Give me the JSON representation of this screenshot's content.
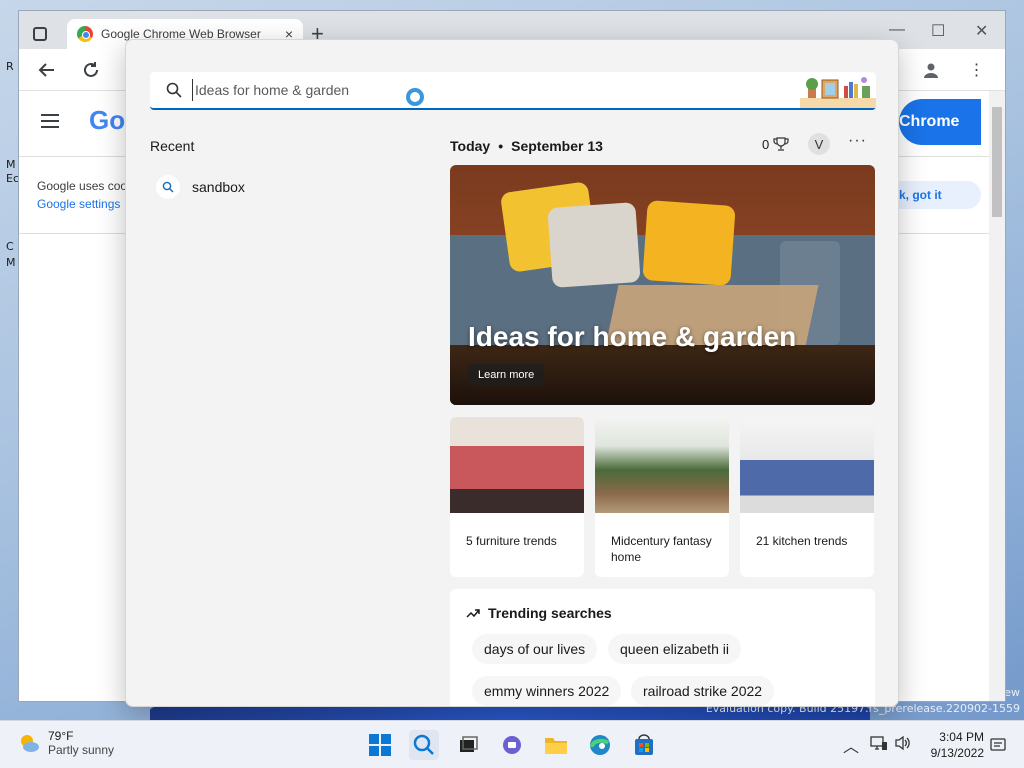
{
  "desktop": {
    "icon_fragments": [
      "R",
      "M",
      "Ec",
      "C",
      "M"
    ],
    "watermark": "Evaluation copy. Build 25197.rs_prerelease.220902-1559",
    "watermark_top": "ew"
  },
  "chrome": {
    "tab_title": "Google Chrome Web Browser",
    "tab_close": "×",
    "new_tab": "+",
    "minimize": "—",
    "maximize": "☐",
    "close": "✕",
    "logo_text": "Goo",
    "get_chrome_label": "Chrome",
    "consent_text": "Google uses coo",
    "consent_link": "Google settings",
    "got_it_label": "k, got it"
  },
  "search": {
    "placeholder": "Ideas for home & garden",
    "recent_heading": "Recent",
    "recent_items": [
      {
        "label": "sandbox"
      }
    ],
    "today_label": "Today",
    "date_label": "September 13",
    "points": "0",
    "avatar_initial": "V",
    "more": "···",
    "hero": {
      "title": "Ideas for home & garden",
      "button": "Learn more"
    },
    "cards": [
      {
        "label": "5 furniture trends"
      },
      {
        "label": "Midcentury fantasy home"
      },
      {
        "label": "21 kitchen trends"
      }
    ],
    "trending": {
      "heading": "Trending searches",
      "chips": [
        "days of our lives",
        "queen elizabeth ii",
        "emmy winners 2022",
        "railroad strike 2022"
      ]
    }
  },
  "taskbar": {
    "weather_temp": "79°F",
    "weather_desc": "Partly sunny",
    "time": "3:04 PM",
    "date": "9/13/2022"
  },
  "colors": {
    "accent": "#0067c0",
    "chrome_blue": "#1a73e8"
  }
}
